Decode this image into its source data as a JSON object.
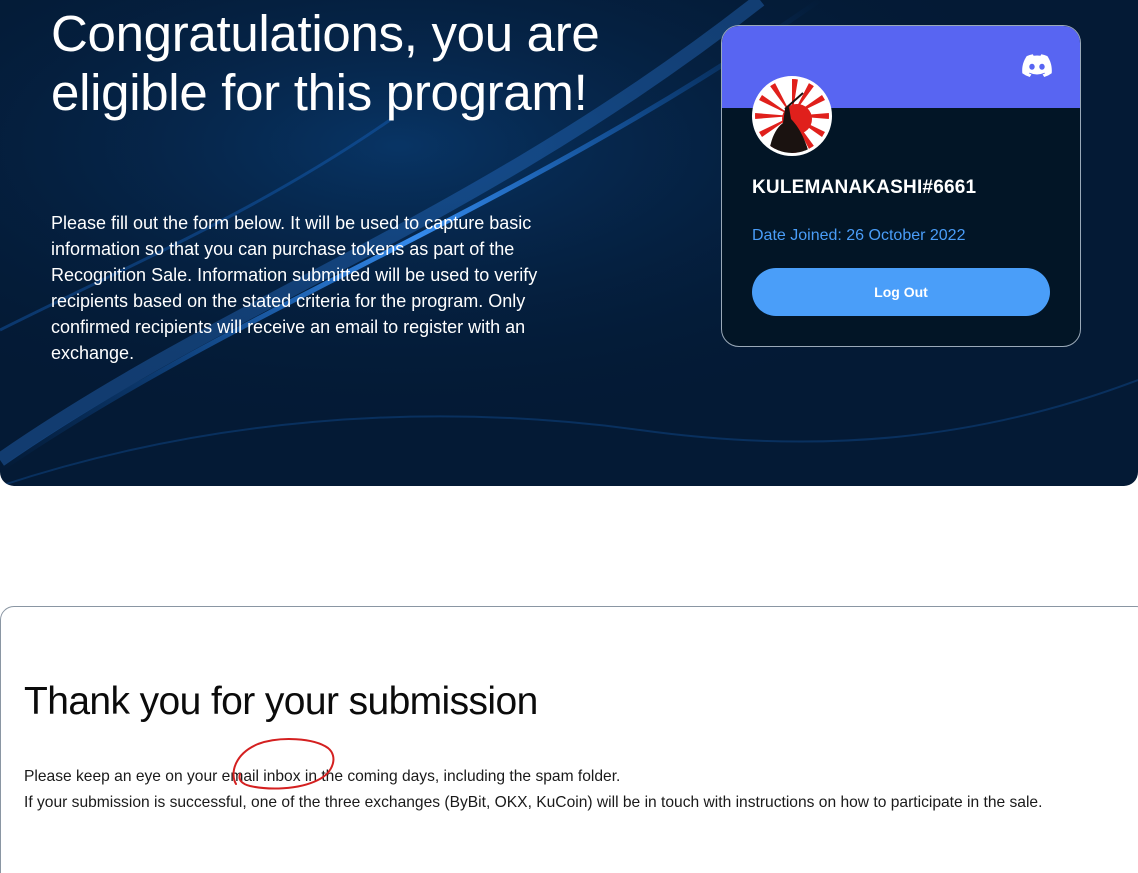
{
  "hero": {
    "title": "Congratulations, you are eligible for this program!",
    "description": "Please fill out the form below. It will be used to capture basic information so that you can purchase tokens as part of the Recognition Sale. Information submitted will be used to verify recipients based on the stated criteria for the program. Only confirmed recipients will receive an email to register with an exchange."
  },
  "profile_card": {
    "platform_icon": "discord-icon",
    "username": "KULEMANAKASHI#6661",
    "date_joined": "Date Joined: 26 October 2022",
    "logout_label": "Log Out"
  },
  "submission": {
    "title": "Thank you for your submission",
    "line1": "Please keep an eye on your email inbox in the coming days, including the spam folder.",
    "line2": "If your submission is successful, one of the three exchanges (ByBit, OKX, KuCoin) will be in touch with instructions on how to participate in the sale."
  },
  "colors": {
    "hero_bg": "#041a35",
    "discord_banner": "#5865f2",
    "accent_blue": "#4a9ef9",
    "annotation_red": "#d42020"
  }
}
